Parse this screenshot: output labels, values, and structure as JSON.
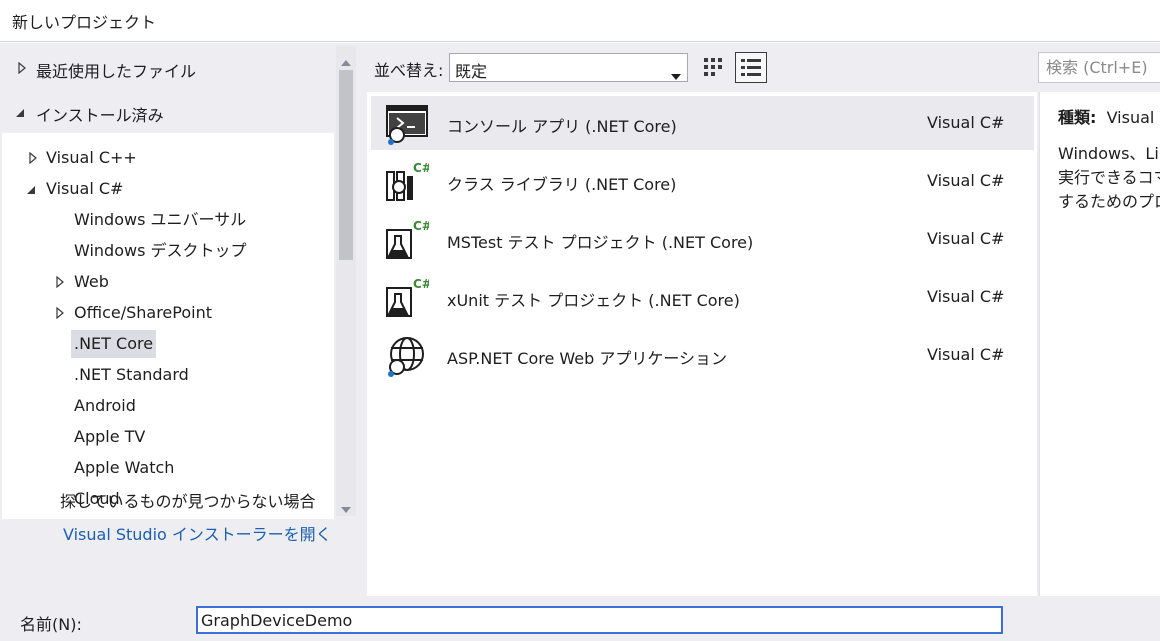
{
  "window": {
    "title": "新しいプロジェクト"
  },
  "left_pane": {
    "recent_label": "最近使用したファイル",
    "installed_label": "インストール済み",
    "tree": {
      "vcpp": "Visual C++",
      "vcs": "Visual C#",
      "win_universal": "Windows ユニバーサル",
      "win_desktop": "Windows デスクトップ",
      "web": "Web",
      "office": "Office/SharePoint",
      "netcore": ".NET Core",
      "netstd": ".NET Standard",
      "android": "Android",
      "appletv": "Apple TV",
      "applewatch": "Apple Watch",
      "cloud": "Cloud"
    },
    "not_found_text": "探しているものが見つからない場合",
    "installer_link": "Visual Studio インストーラーを開く"
  },
  "toolbar": {
    "sort_label": "並べ替え:",
    "sort_value": "既定",
    "search_placeholder": "検索 (Ctrl+E)"
  },
  "templates": [
    {
      "name": "コンソール アプリ (.NET Core)",
      "lang": "Visual C#",
      "icon": "console-app-icon"
    },
    {
      "name": "クラス ライブラリ (.NET Core)",
      "lang": "Visual C#",
      "icon": "class-library-icon"
    },
    {
      "name": "MSTest テスト プロジェクト (.NET Core)",
      "lang": "Visual C#",
      "icon": "test-project-icon"
    },
    {
      "name": "xUnit テスト プロジェクト (.NET Core)",
      "lang": "Visual C#",
      "icon": "test-project-icon"
    },
    {
      "name": "ASP.NET Core Web アプリケーション",
      "lang": "Visual C#",
      "icon": "web-app-icon"
    }
  ],
  "detail": {
    "type_label": "種類:",
    "type_value": "Visual",
    "desc_line1": "Windows、Lin",
    "desc_line2": "実行できるコマ",
    "desc_line3": "するためのプロ"
  },
  "bottom": {
    "name_label": "名前(N):",
    "name_value": "GraphDeviceDemo"
  },
  "colors": {
    "link": "#1a5fb4",
    "focus_border": "#3c6fd8",
    "csharp_green": "#388a34",
    "selection": "#e9e9ee"
  }
}
